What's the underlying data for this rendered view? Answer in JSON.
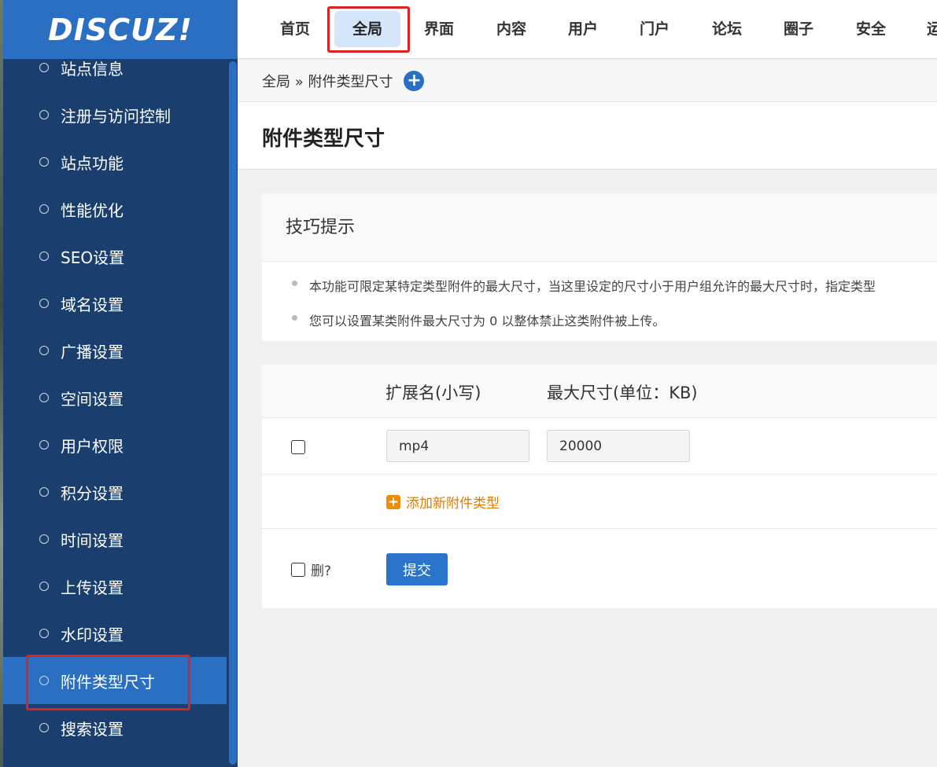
{
  "logo": {
    "text": "DISCUZ!"
  },
  "sidebar": {
    "items": [
      {
        "label": "站点信息"
      },
      {
        "label": "注册与访问控制"
      },
      {
        "label": "站点功能"
      },
      {
        "label": "性能优化"
      },
      {
        "label": "SEO设置"
      },
      {
        "label": "域名设置"
      },
      {
        "label": "广播设置"
      },
      {
        "label": "空间设置"
      },
      {
        "label": "用户权限"
      },
      {
        "label": "积分设置"
      },
      {
        "label": "时间设置"
      },
      {
        "label": "上传设置"
      },
      {
        "label": "水印设置"
      },
      {
        "label": "附件类型尺寸",
        "active": true
      },
      {
        "label": "搜索设置"
      }
    ]
  },
  "topnav": {
    "items": [
      {
        "label": "首页"
      },
      {
        "label": "全局",
        "active": true
      },
      {
        "label": "界面"
      },
      {
        "label": "内容"
      },
      {
        "label": "用户"
      },
      {
        "label": "门户"
      },
      {
        "label": "论坛"
      },
      {
        "label": "圈子"
      },
      {
        "label": "安全"
      },
      {
        "label": "运"
      }
    ]
  },
  "breadcrumb": {
    "text": "全局 » 附件类型尺寸",
    "plus": "+"
  },
  "page": {
    "title": "附件类型尺寸"
  },
  "tips": {
    "title": "技巧提示",
    "lines": [
      "本功能可限定某特定类型附件的最大尺寸，当这里设定的尺寸小于用户组允许的最大尺寸时，指定类型",
      "您可以设置某类附件最大尺寸为 0 以整体禁止这类附件被上传。"
    ]
  },
  "table": {
    "headers": {
      "ext": "扩展名(小写)",
      "maxsize": "最大尺寸(单位：KB)"
    },
    "rows": [
      {
        "ext": "mp4",
        "maxsize": "20000"
      }
    ],
    "add_label": "添加新附件类型",
    "add_icon": "+",
    "delete_label": "删?",
    "submit_label": "提交"
  }
}
